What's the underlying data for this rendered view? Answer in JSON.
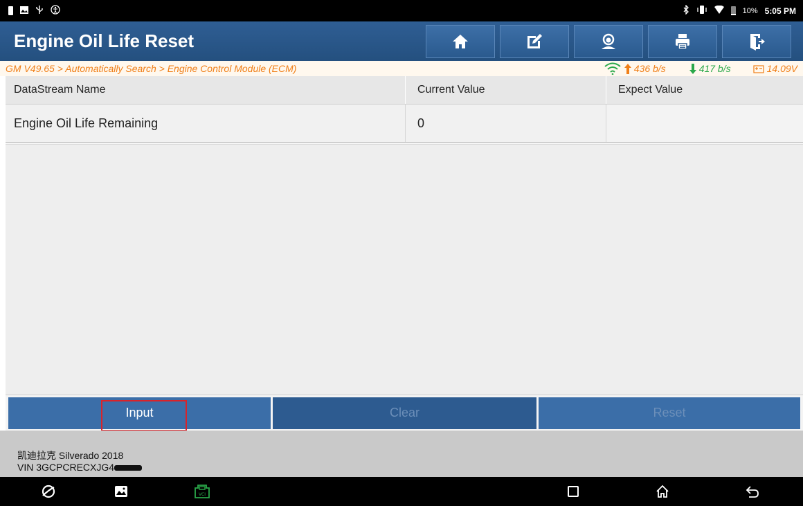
{
  "status_bar": {
    "left_icons": [
      "notification-icon",
      "image-icon",
      "usb-icon",
      "accessibility-icon"
    ],
    "right_icons": [
      "bluetooth-icon",
      "vibrate-icon",
      "wifi-icon",
      "battery-icon"
    ],
    "battery": "10%",
    "time": "5:05 PM"
  },
  "header": {
    "title": "Engine Oil Life Reset",
    "buttons": [
      {
        "name": "home-icon"
      },
      {
        "name": "edit-icon"
      },
      {
        "name": "support-icon"
      },
      {
        "name": "print-icon"
      },
      {
        "name": "exit-icon"
      }
    ]
  },
  "breadcrumb": {
    "path": "GM V49.65 > Automatically Search > Engine Control Module (ECM)",
    "upload_rate": "436 b/s",
    "download_rate": "417 b/s",
    "voltage": "14.09V"
  },
  "table": {
    "headers": [
      "DataStream Name",
      "Current Value",
      "Expect Value"
    ],
    "rows": [
      {
        "name": "Engine Oil Life Remaining",
        "current": "0",
        "expect": ""
      }
    ]
  },
  "actions": {
    "input": "Input",
    "clear": "Clear",
    "reset": "Reset"
  },
  "vehicle": {
    "model": "凯迪拉克 Silverado 2018",
    "vin": "VIN 3GCPCRECXJG4"
  },
  "colors": {
    "header_blue": "#2a5a8e",
    "accent_orange": "#f07f18",
    "download_green": "#2aa84a",
    "highlight_red": "#d9232a"
  }
}
